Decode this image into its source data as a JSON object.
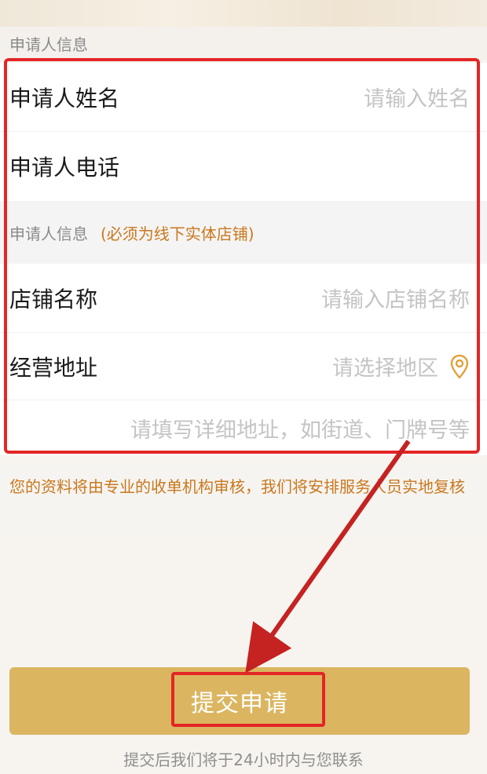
{
  "sections": {
    "applicant_header": "申请人信息",
    "store_header": "申请人信息",
    "store_note": "(必须为线下实体店铺)"
  },
  "fields": {
    "name": {
      "label": "申请人姓名",
      "placeholder": "请输入姓名"
    },
    "phone": {
      "label": "申请人电话",
      "placeholder": ""
    },
    "store_name": {
      "label": "店铺名称",
      "placeholder": "请输入店铺名称"
    },
    "address": {
      "label": "经营地址",
      "placeholder": "请选择地区",
      "icon": "location-pin-icon"
    },
    "detail_address": {
      "placeholder": "请填写详细地址，如街道、门牌号等"
    }
  },
  "notice": "您的资料将由专业的收单机构审核，我们将安排服务人员实地复核",
  "submit_label": "提交申请",
  "footer_text": "提交后我们将于24小时内与您联系",
  "colors": {
    "accent_orange": "#c9781d",
    "button_gold": "#dbb560",
    "highlight_red": "#e32626"
  }
}
